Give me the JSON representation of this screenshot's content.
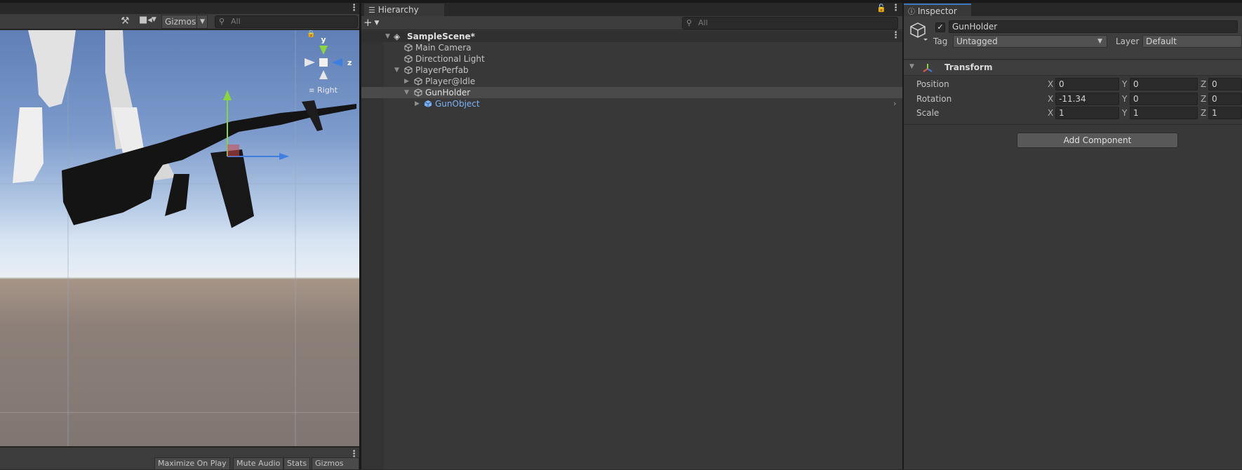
{
  "scene": {
    "gizmos_label": "Gizmos",
    "search_placeholder": "All",
    "axis_y": "y",
    "axis_z": "z",
    "view_label": "Right"
  },
  "game": {
    "buttons": [
      "Maximize On Play",
      "Mute Audio",
      "Stats",
      "Gizmos"
    ]
  },
  "hierarchy": {
    "tab_label": "Hierarchy",
    "search_placeholder": "All",
    "scene_name": "SampleScene*",
    "items": [
      {
        "label": "Main Camera"
      },
      {
        "label": "Directional Light"
      },
      {
        "label": "PlayerPerfab"
      },
      {
        "label": "Player@Idle"
      },
      {
        "label": "GunHolder"
      },
      {
        "label": "GunObject"
      }
    ]
  },
  "inspector": {
    "tab_label": "Inspector",
    "object_name": "GunHolder",
    "tag_label": "Tag",
    "tag_value": "Untagged",
    "layer_label": "Layer",
    "layer_value": "Default",
    "component_name": "Transform",
    "rows": [
      {
        "label": "Position",
        "x": "0",
        "y": "0",
        "z": "0"
      },
      {
        "label": "Rotation",
        "x": "-11.34",
        "y": "0",
        "z": "0"
      },
      {
        "label": "Scale",
        "x": "1",
        "y": "1",
        "z": "1"
      }
    ],
    "axis_labels": [
      "X",
      "Y",
      "Z"
    ],
    "add_component_label": "Add Component"
  },
  "colors": {
    "accent": "#3a79bb",
    "prefab_blue": "#7ab4f5",
    "panel_bg": "#383838"
  }
}
